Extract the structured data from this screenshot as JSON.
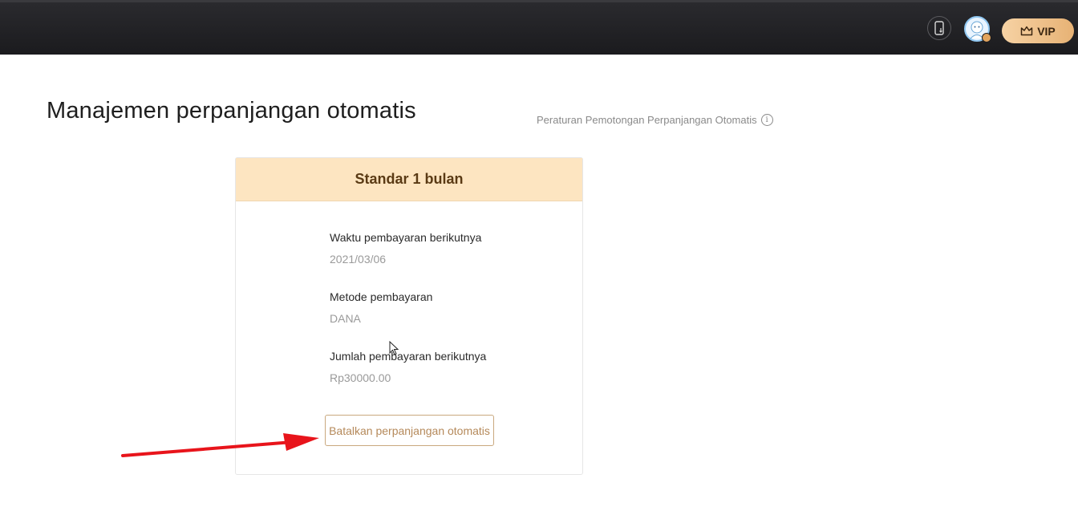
{
  "header": {
    "vip_label": "VIP",
    "icons": [
      "phone-download-icon",
      "user-avatar",
      "crown-icon"
    ]
  },
  "page": {
    "title": "Manajemen perpanjangan otomatis",
    "rules_link": "Peraturan Pemotongan Perpanjangan Otomatis",
    "info_glyph": "i"
  },
  "plan": {
    "name": "Standar 1 bulan",
    "fields": [
      {
        "label": "Waktu pembayaran berikutnya",
        "value": "2021/03/06"
      },
      {
        "label": "Metode pembayaran",
        "value": "DANA"
      },
      {
        "label": "Jumlah pembayaran berikutnya",
        "value": "Rp30000.00"
      }
    ],
    "cancel_label": "Batalkan perpanjangan otomatis"
  },
  "colors": {
    "header_bg": "#1e1e21",
    "vip_gold": "#e7b275",
    "card_head": "#fde5c1",
    "annotation_arrow": "#e8141b"
  }
}
